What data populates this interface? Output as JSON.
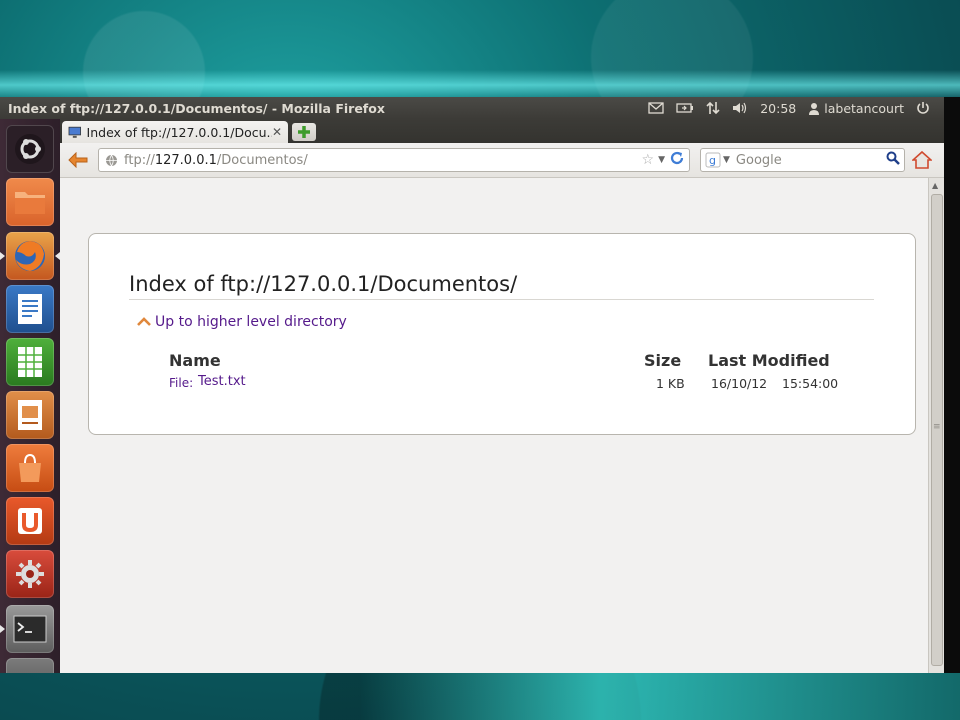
{
  "window": {
    "title": "Index of ftp://127.0.0.1/Documentos/ - Mozilla Firefox"
  },
  "panel": {
    "time": "20:58",
    "user": "labetancourt"
  },
  "tab": {
    "label": "Index of ftp://127.0.0.1/Docu..."
  },
  "url": {
    "scheme": "ftp://",
    "host": "127.0.0.1",
    "path": "/Documentos/"
  },
  "search": {
    "placeholder": "Google"
  },
  "page": {
    "title": "Index of ftp://127.0.0.1/Documentos/",
    "up_link": "Up to higher level directory",
    "columns": {
      "name": "Name",
      "size": "Size",
      "modified": "Last Modified"
    },
    "files": [
      {
        "prefix": "File:",
        "name": "Test.txt",
        "size": "1 KB",
        "date": "16/10/12",
        "time": "15:54:00"
      }
    ]
  },
  "colors": {
    "link_visited": "#551a8b",
    "launcher_bg": "#3e2a36",
    "panel_bg": "#3c3b37"
  }
}
